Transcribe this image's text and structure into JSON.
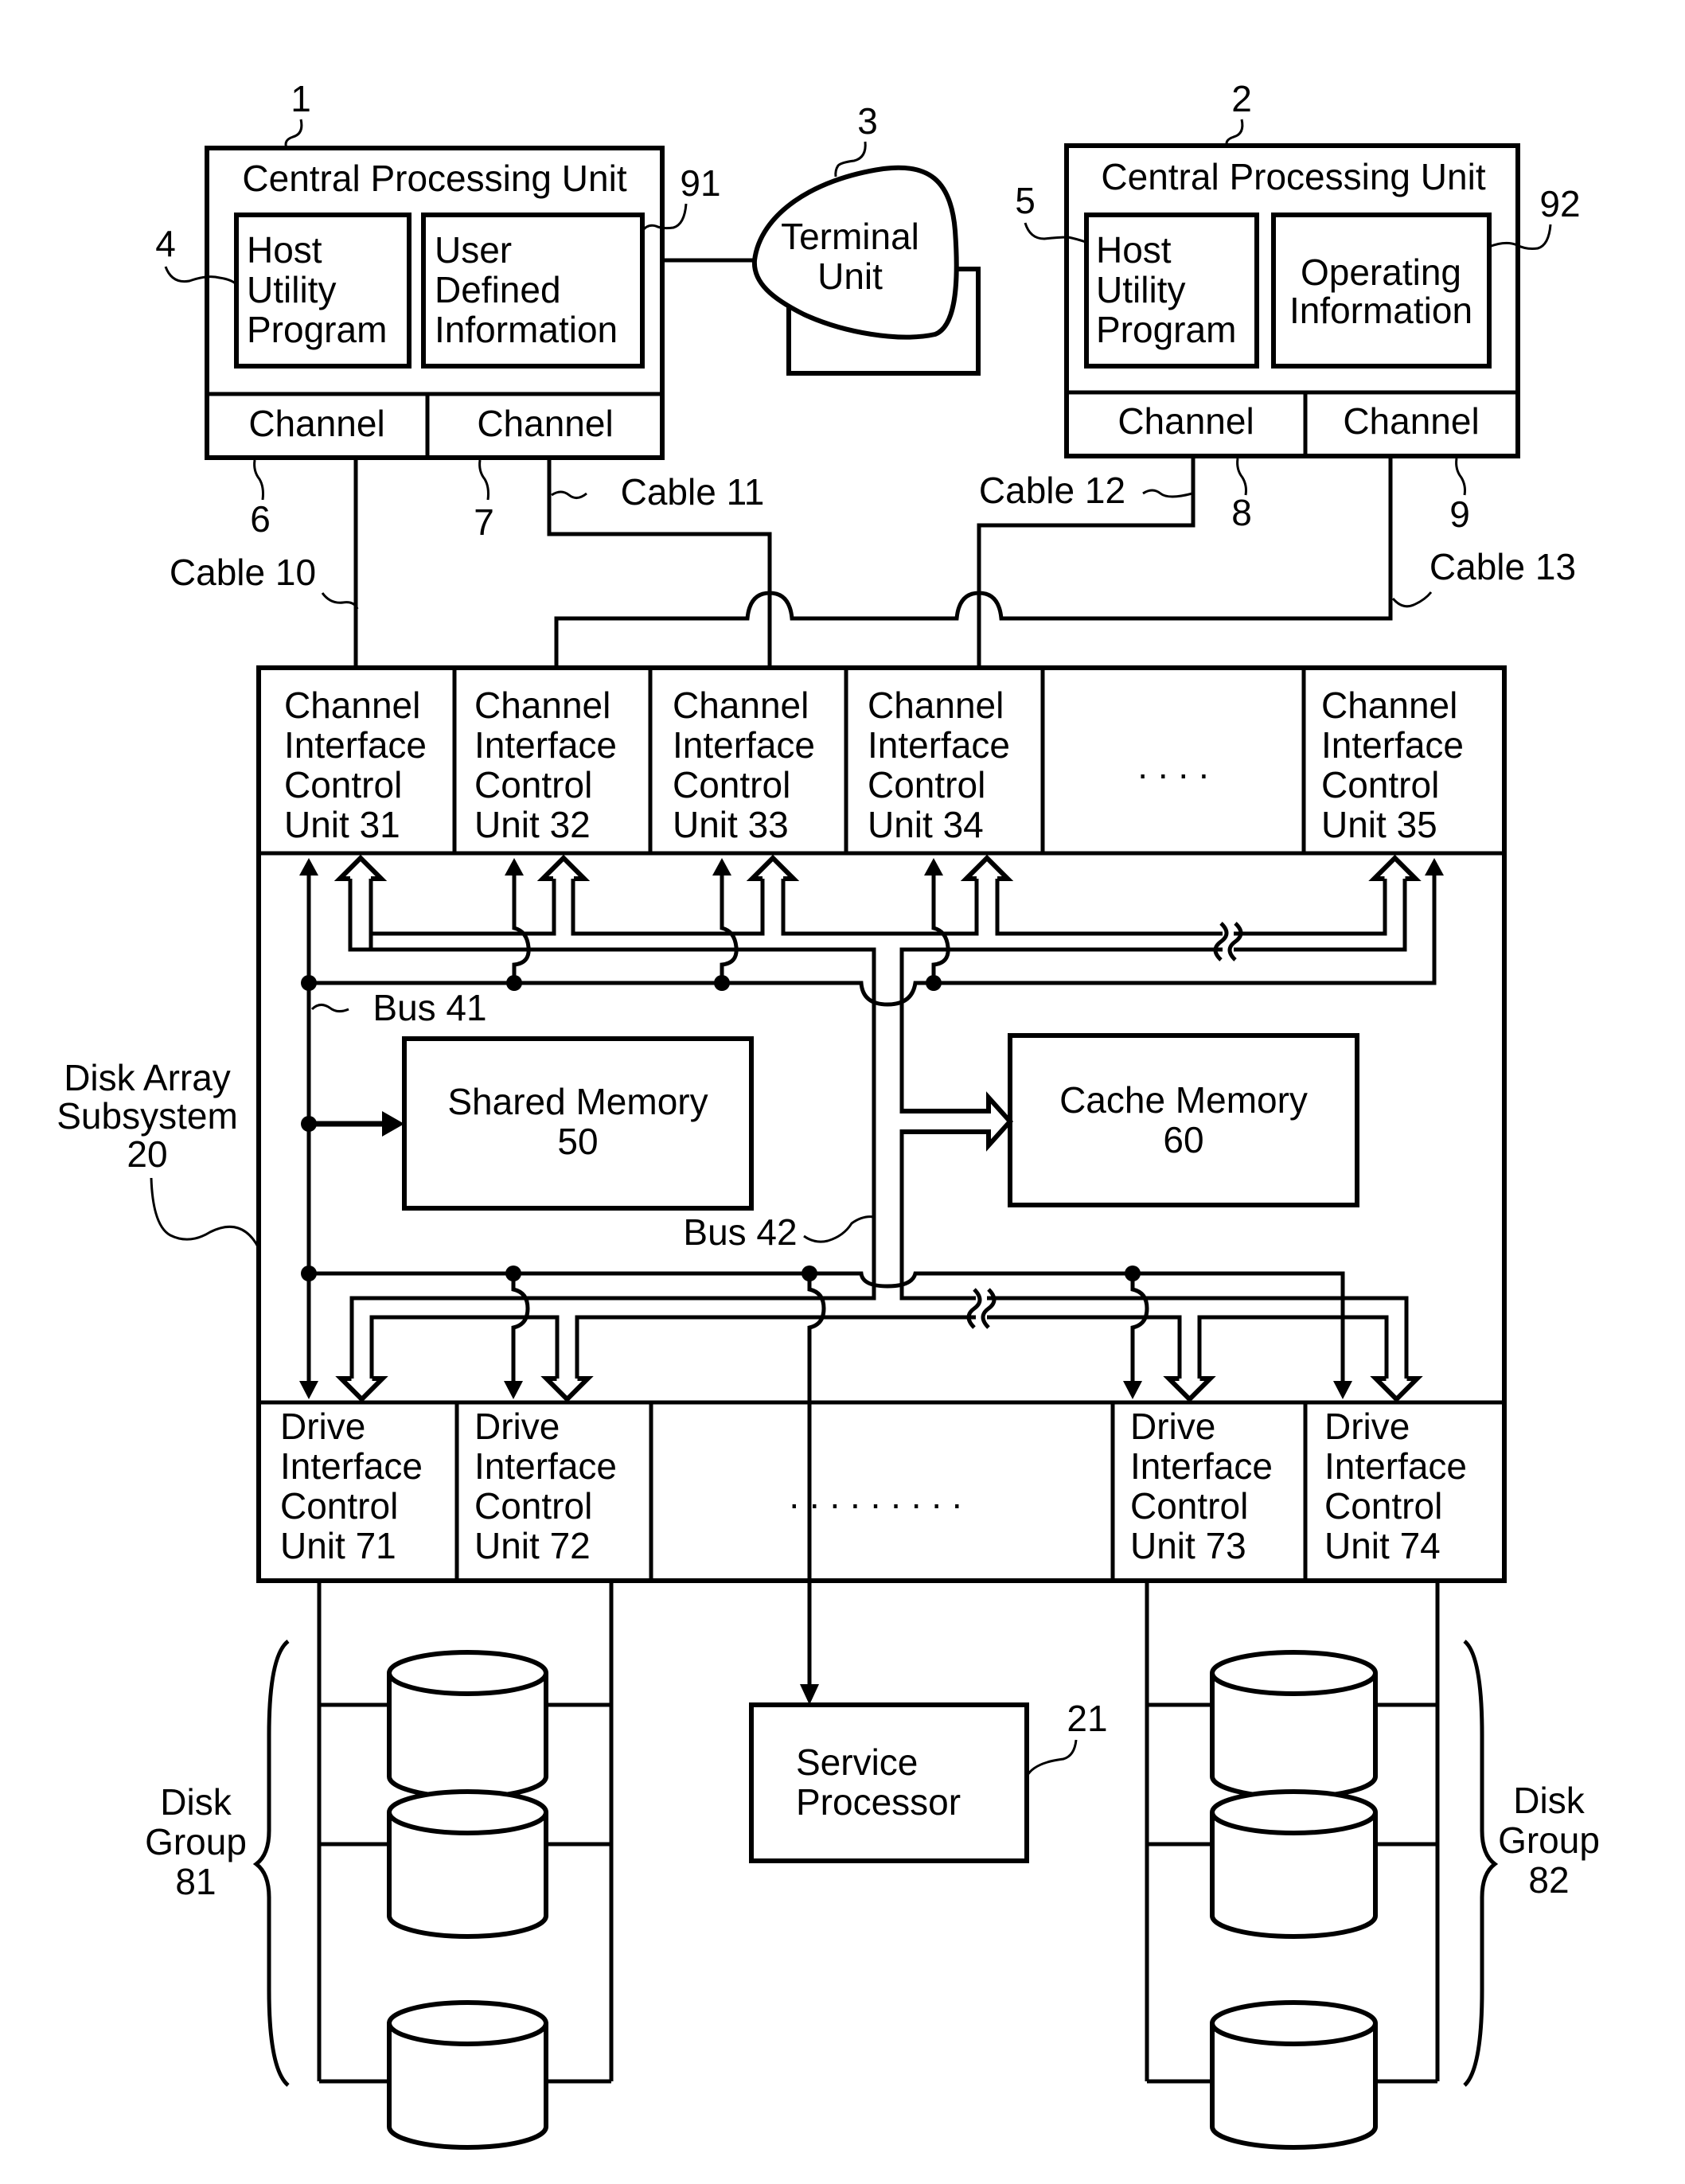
{
  "figure": {
    "cpu1": {
      "ref": "1",
      "title": "Central Processing Unit",
      "host_utility": {
        "ref": "4",
        "lines": [
          "Host",
          "Utility",
          "Program"
        ]
      },
      "user_defined": {
        "ref": "91",
        "lines": [
          "User",
          "Defined",
          "Information"
        ]
      },
      "channels": [
        {
          "label": "Channel",
          "ref": "6"
        },
        {
          "label": "Channel",
          "ref": "7"
        }
      ]
    },
    "terminal": {
      "ref": "3",
      "lines": [
        "Terminal",
        "Unit"
      ]
    },
    "cpu2": {
      "ref": "2",
      "title": "Central Processing Unit",
      "host_utility": {
        "ref": "5",
        "lines": [
          "Host",
          "Utility",
          "Program"
        ]
      },
      "operating_info": {
        "ref": "92",
        "lines": [
          "Operating",
          "Information"
        ]
      },
      "channels": [
        {
          "label": "Channel",
          "ref": "8"
        },
        {
          "label": "Channel",
          "ref": "9"
        }
      ]
    },
    "cables": [
      "Cable 10",
      "Cable 11",
      "Cable 12",
      "Cable 13"
    ],
    "subsystem": {
      "lines": [
        "Disk Array",
        "Subsystem",
        "20"
      ]
    },
    "channel_interface_units": [
      {
        "lines": [
          "Channel",
          "Interface",
          "Control",
          "Unit 31"
        ]
      },
      {
        "lines": [
          "Channel",
          "Interface",
          "Control",
          "Unit 32"
        ]
      },
      {
        "lines": [
          "Channel",
          "Interface",
          "Control",
          "Unit 33"
        ]
      },
      {
        "lines": [
          "Channel",
          "Interface",
          "Control",
          "Unit 34"
        ]
      },
      {
        "lines": [
          "Channel",
          "Interface",
          "Control",
          "Unit 35"
        ]
      }
    ],
    "channel_ellipsis": ". . . .",
    "bus41": "Bus 41",
    "bus42": "Bus 42",
    "shared_memory": {
      "lines": [
        "Shared Memory",
        "50"
      ]
    },
    "cache_memory": {
      "lines": [
        "Cache Memory",
        "60"
      ]
    },
    "drive_interface_units": [
      {
        "lines": [
          "Drive",
          "Interface",
          "Control",
          "Unit 71"
        ]
      },
      {
        "lines": [
          "Drive",
          "Interface",
          "Control",
          "Unit 72"
        ]
      },
      {
        "lines": [
          "Drive",
          "Interface",
          "Control",
          "Unit 73"
        ]
      },
      {
        "lines": [
          "Drive",
          "Interface",
          "Control",
          "Unit 74"
        ]
      }
    ],
    "drive_ellipsis": ". . . . . . . . .",
    "service_processor": {
      "ref": "21",
      "lines": [
        "Service",
        "Processor"
      ]
    },
    "disk_group_81": {
      "lines": [
        "Disk",
        "Group",
        "81"
      ]
    },
    "disk_group_82": {
      "lines": [
        "Disk",
        "Group",
        "82"
      ]
    }
  }
}
